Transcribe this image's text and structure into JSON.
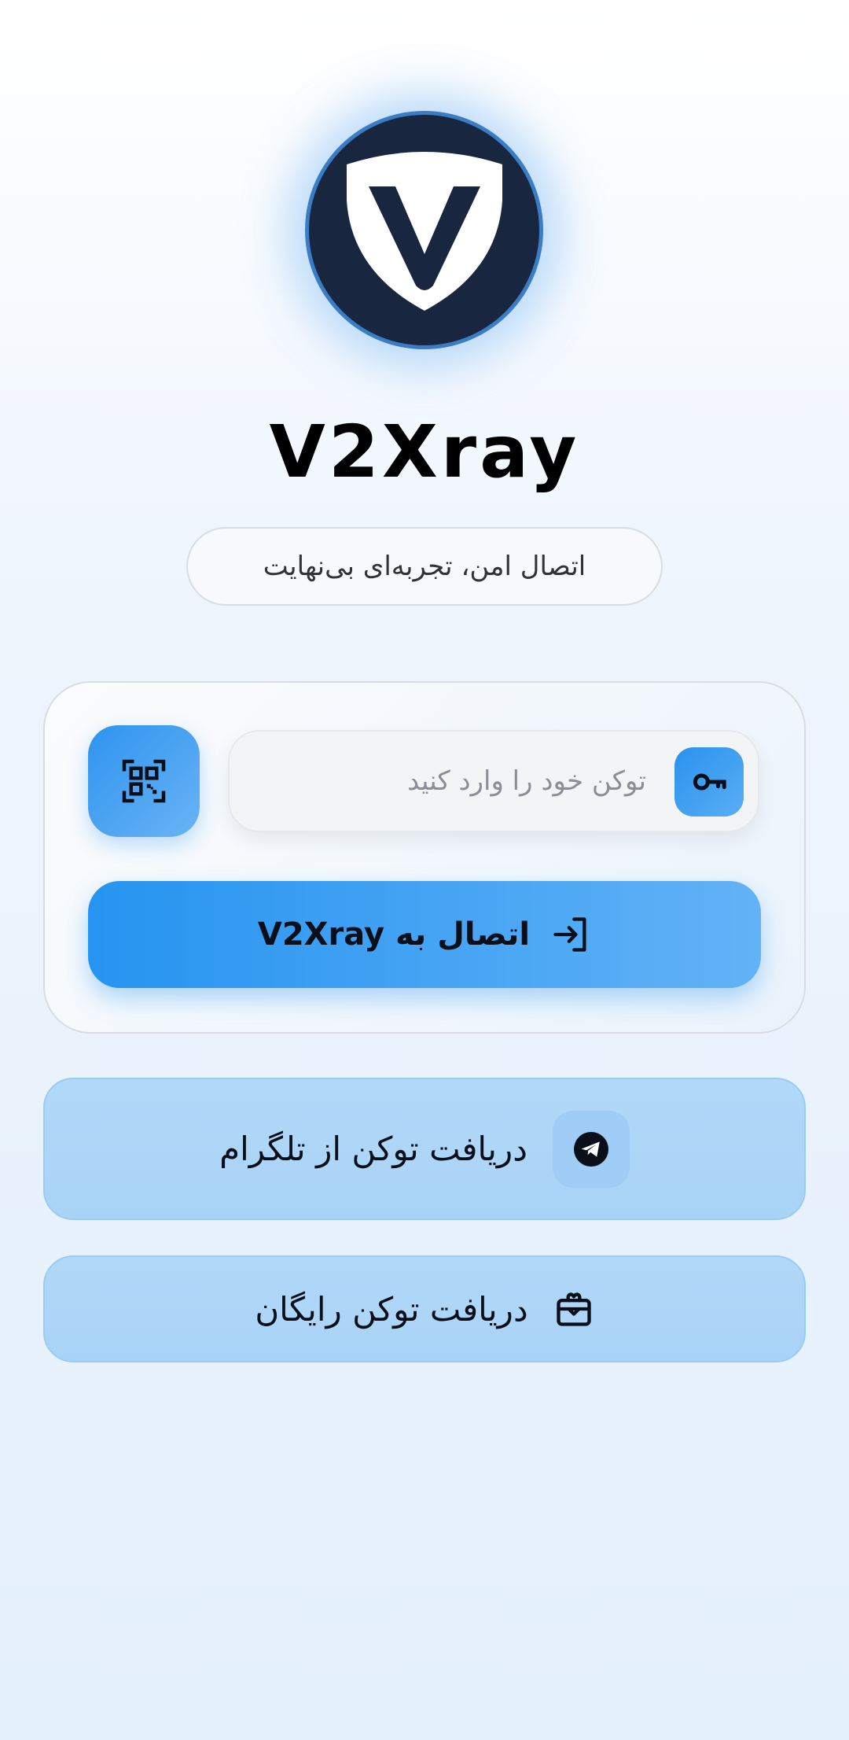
{
  "app": {
    "logo_icon": "shield-v-logo-icon",
    "title": "V2Xray",
    "tagline": "اتصال امن، تجربه‌ای بی‌نهایت"
  },
  "login_card": {
    "qr_button_icon": "qr-code-scan-icon",
    "token_input": {
      "value": "",
      "placeholder": "توکن خود را وارد کنید",
      "icon": "key-icon"
    },
    "connect_button": {
      "label": "اتصال به V2Xray",
      "icon": "login-arrow-icon"
    }
  },
  "actions": {
    "telegram": {
      "label": "دریافت توکن از تلگرام",
      "icon": "telegram-icon"
    },
    "free_token": {
      "label": "دریافت توکن رایگان",
      "icon": "gift-icon"
    }
  },
  "colors": {
    "logo_bg": "#182640",
    "accent": "#2694f0",
    "accent_light": "#62b2f6",
    "action_bg": "#b1d8f8"
  }
}
